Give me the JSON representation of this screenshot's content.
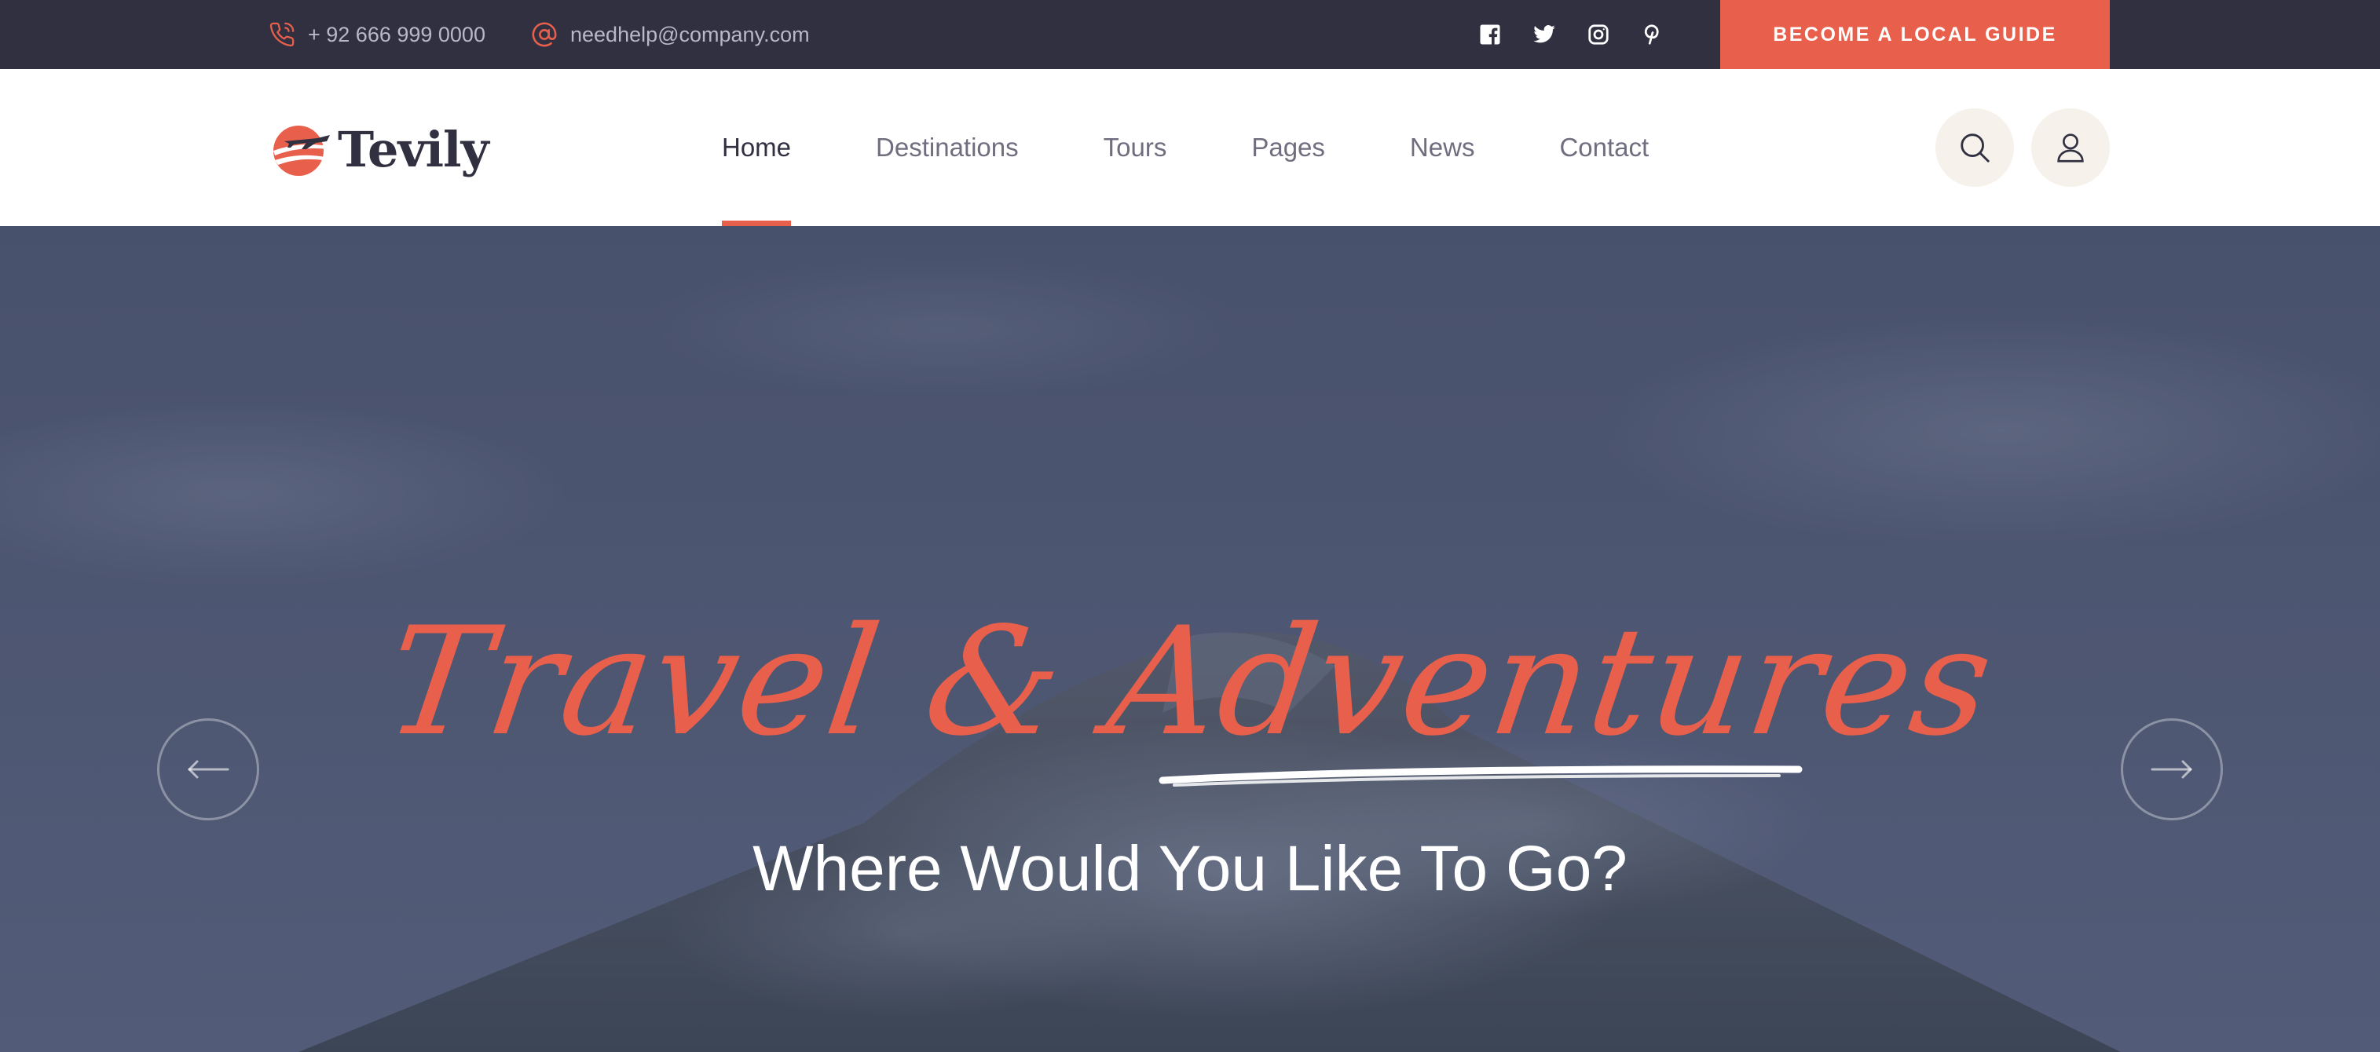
{
  "topbar": {
    "phone": "+ 92 666 999 0000",
    "email": "needhelp@company.com",
    "social_icons": [
      "facebook-icon",
      "twitter-icon",
      "instagram-icon",
      "pinterest-icon"
    ],
    "cta_label": "BECOME A LOCAL GUIDE"
  },
  "header": {
    "logo_text": "Tevily",
    "nav": [
      {
        "label": "Home",
        "active": true
      },
      {
        "label": "Destinations"
      },
      {
        "label": "Tours"
      },
      {
        "label": "Pages"
      },
      {
        "label": "News"
      },
      {
        "label": "Contact"
      }
    ],
    "icons": [
      "search-icon",
      "user-icon"
    ]
  },
  "hero": {
    "script_title": "Travel & Adventures",
    "subtitle": "Where Would You Like To Go?",
    "prev_icon": "arrow-left-icon",
    "next_icon": "arrow-right-icon"
  },
  "colors": {
    "accent": "#e8604c",
    "dark": "#313041",
    "nav_text": "#6f6e7e",
    "round_btn_bg": "#f6f1ea"
  }
}
